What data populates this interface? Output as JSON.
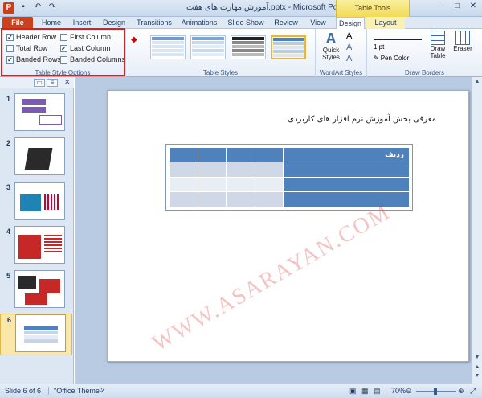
{
  "title_bar": {
    "doc_title": "آموزش مهارت های هفت.pptx - Microsoft PowerPoint",
    "contextual": "Table Tools",
    "qat": [
      "save-icon",
      "undo-icon",
      "redo-icon"
    ]
  },
  "tabs": [
    "File",
    "Home",
    "Insert",
    "Design",
    "Transitions",
    "Animations",
    "Slide Show",
    "Review",
    "View",
    "Design",
    "Layout"
  ],
  "table_style_options": {
    "group_label": "Table Style Options",
    "options": [
      {
        "label": "Header Row",
        "checked": true
      },
      {
        "label": "Total Row",
        "checked": false
      },
      {
        "label": "Banded Rows",
        "checked": true
      },
      {
        "label": "First Column",
        "checked": false
      },
      {
        "label": "Last Column",
        "checked": true
      },
      {
        "label": "Banded Columns",
        "checked": false
      }
    ]
  },
  "table_styles": {
    "group_label": "Table Styles"
  },
  "wordart": {
    "group_label": "WordArt Styles",
    "quick_styles": "Quick Styles"
  },
  "draw_borders": {
    "group_label": "Draw Borders",
    "pen_weight": "1 pt",
    "pen_color": "Pen Color",
    "draw_table": "Draw Table",
    "eraser": "Eraser"
  },
  "slides": [
    "1",
    "2",
    "3",
    "4",
    "5",
    "6"
  ],
  "slide": {
    "title": "معرفی بخش آموزش نرم افزار های کاربردی",
    "header_cell": "ردیف"
  },
  "watermark": "WWW.ASARAYAN.COM",
  "status": {
    "slide_info": "Slide 6 of 6",
    "theme": "\"Office Theme\"",
    "zoom": "70%"
  },
  "colors": {
    "accent": "#4f81bd",
    "file_tab": "#c8431d",
    "highlight": "#e01e1e"
  }
}
